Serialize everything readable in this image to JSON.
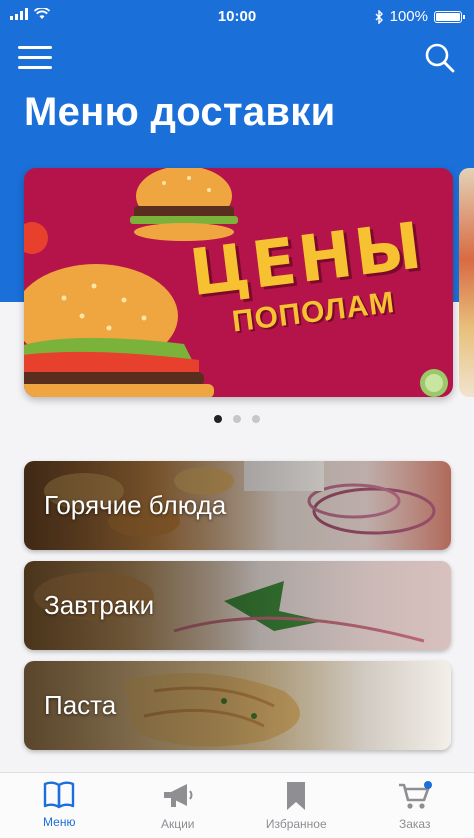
{
  "status_bar": {
    "time": "10:00",
    "battery": "100%"
  },
  "header": {
    "title": "Меню доставки"
  },
  "banner": {
    "headline": "ЦЕНЫ",
    "subline": "пополам",
    "dots_count": 3,
    "active_dot": 0
  },
  "categories": [
    {
      "label": "Горячие блюда"
    },
    {
      "label": "Завтраки"
    },
    {
      "label": "Паста"
    }
  ],
  "tabs": [
    {
      "label": "Меню",
      "icon": "book-icon",
      "active": true
    },
    {
      "label": "Акции",
      "icon": "megaphone-icon",
      "active": false
    },
    {
      "label": "Избранное",
      "icon": "bookmark-icon",
      "active": false
    },
    {
      "label": "Заказ",
      "icon": "cart-icon",
      "active": false,
      "badge_dot": true
    }
  ],
  "colors": {
    "accent": "#1b6fd8",
    "inactive": "#8e8e93",
    "banner_bg": "#b5144a",
    "badge": "#1b6fd8"
  }
}
